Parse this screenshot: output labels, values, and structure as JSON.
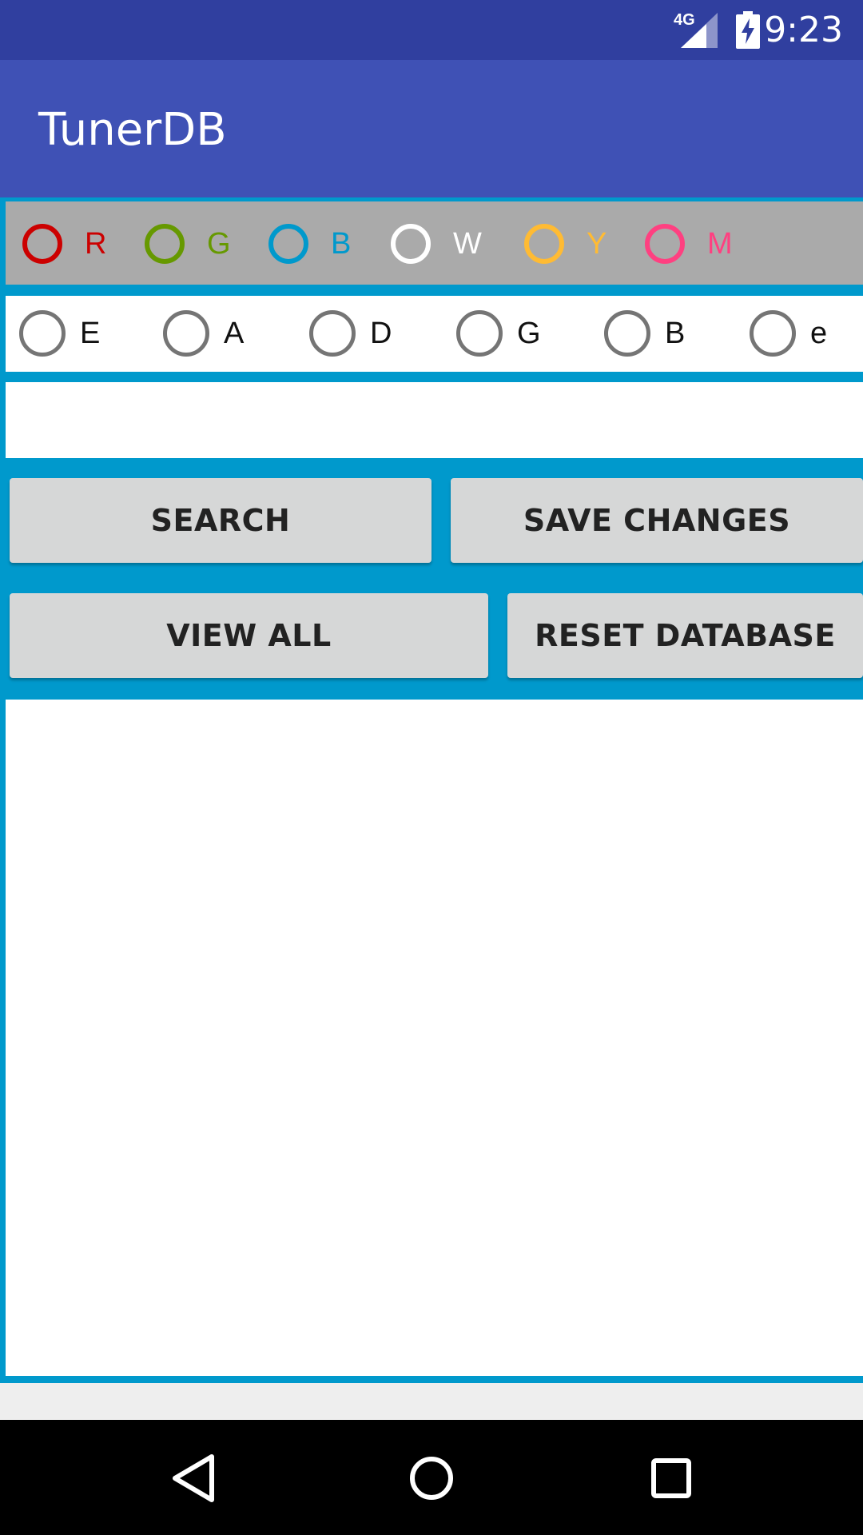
{
  "status_bar": {
    "network": "4G",
    "time": "9:23",
    "icons": [
      "signal-icon",
      "battery-charging-icon"
    ]
  },
  "app": {
    "title": "TunerDB"
  },
  "color_options": [
    {
      "label": "R",
      "color": "#cc0000"
    },
    {
      "label": "G",
      "color": "#669900"
    },
    {
      "label": "B",
      "color": "#0099cc"
    },
    {
      "label": "W",
      "color": "#ffffff"
    },
    {
      "label": "Y",
      "color": "#ffbb33"
    },
    {
      "label": "M",
      "color": "#ff4081"
    }
  ],
  "string_options": [
    {
      "label": "E"
    },
    {
      "label": "A"
    },
    {
      "label": "D"
    },
    {
      "label": "G"
    },
    {
      "label": "B"
    },
    {
      "label": "e"
    }
  ],
  "search": {
    "value": "",
    "placeholder": ""
  },
  "buttons": {
    "search": "SEARCH",
    "save_changes": "SAVE CHANGES",
    "view_all": "VIEW ALL",
    "reset_database": "RESET DATABASE"
  },
  "navigation": {
    "icons": [
      "back-icon",
      "home-icon",
      "recents-icon"
    ]
  },
  "colors": {
    "status_bar": "#303f9f",
    "app_bar": "#3f51b5",
    "frame": "#0099cc",
    "button": "#d6d7d7"
  }
}
